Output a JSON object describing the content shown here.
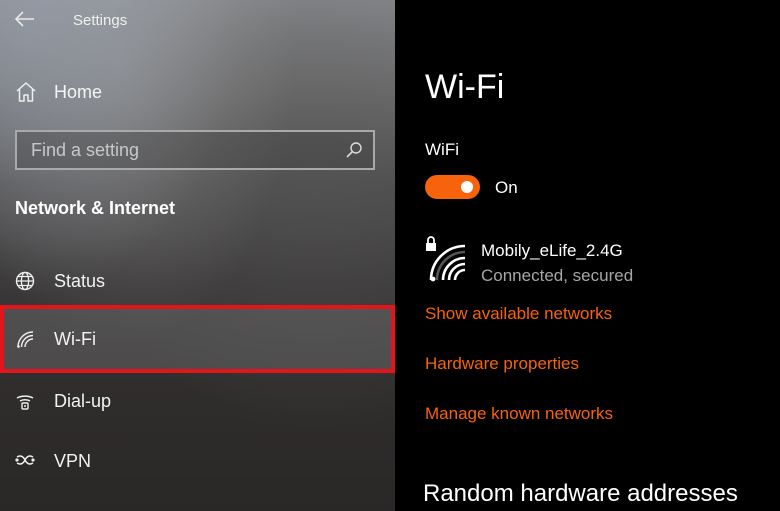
{
  "window": {
    "title": "Settings"
  },
  "sidebar": {
    "home_label": "Home",
    "search": {
      "placeholder": "Find a setting",
      "value": ""
    },
    "section_heading": "Network & Internet",
    "items": [
      {
        "label": "Status",
        "icon": "globe-icon"
      },
      {
        "label": "Wi-Fi",
        "icon": "wifi-icon",
        "selected": true
      },
      {
        "label": "Dial-up",
        "icon": "dialup-icon"
      },
      {
        "label": "VPN",
        "icon": "vpn-icon"
      }
    ]
  },
  "main": {
    "title": "Wi-Fi",
    "wifi_section_label": "WiFi",
    "toggle_state": "On",
    "network": {
      "name": "Mobily_eLife_2.4G",
      "status": "Connected, secured"
    },
    "links": {
      "show_networks": "Show available networks",
      "hardware_properties": "Hardware properties",
      "manage_known": "Manage known networks"
    },
    "random_hw_heading": "Random hardware addresses"
  },
  "colors": {
    "accent": "#f7630c",
    "selection_outline": "#e3141b",
    "secondary_text": "#a6a6a6"
  }
}
